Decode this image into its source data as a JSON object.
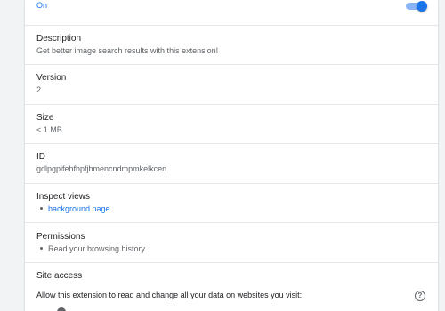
{
  "status": {
    "label": "On",
    "toggle_on": true
  },
  "sections": [
    {
      "label": "Description",
      "value": "Get better image search results with this extension!"
    },
    {
      "label": "Version",
      "value": "2"
    },
    {
      "label": "Size",
      "value": "< 1 MB"
    },
    {
      "label": "ID",
      "value": "gdlpgpifehfhpfjbmencndmpmkelkcen"
    },
    {
      "label": "Inspect views",
      "items": [
        "background page"
      ]
    },
    {
      "label": "Permissions",
      "items": [
        "Read your browsing history"
      ]
    },
    {
      "label": "Site access",
      "prompt": "Allow this extension to read and change all your data on websites you visit:"
    }
  ],
  "colors": {
    "accent": "#1a73e8",
    "text": "#202124",
    "secondary": "#5f6368"
  },
  "icons": {
    "help": "help-circle-icon"
  },
  "help_glyph": "?"
}
